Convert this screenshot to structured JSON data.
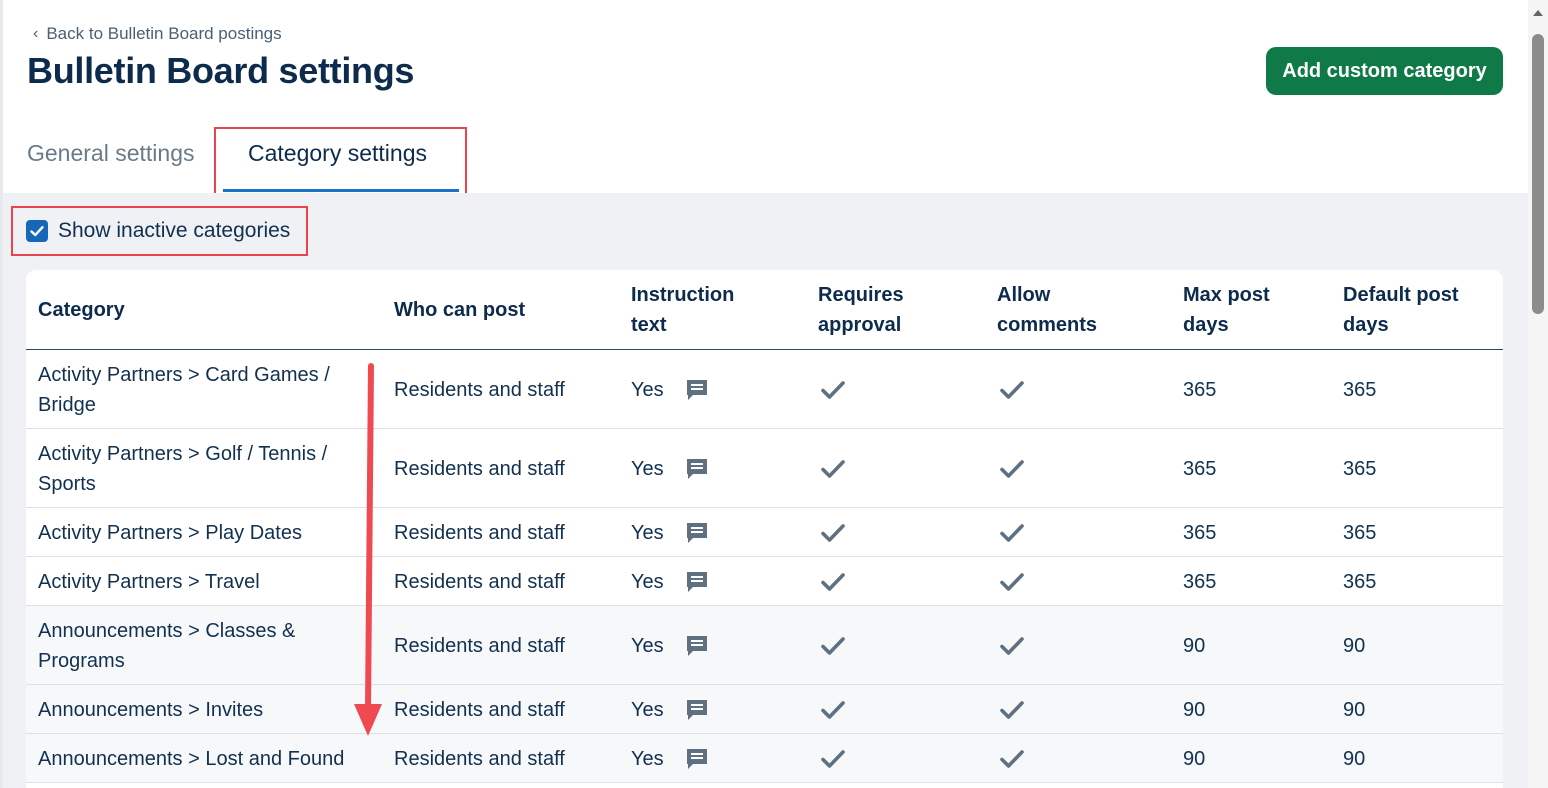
{
  "header": {
    "back_label": "Back to Bulletin Board postings",
    "title": "Bulletin Board settings",
    "add_button": "Add custom category"
  },
  "tabs": [
    {
      "label": "General settings",
      "active": false
    },
    {
      "label": "Category settings",
      "active": true
    }
  ],
  "filter": {
    "show_inactive_label": "Show inactive categories",
    "show_inactive_checked": true
  },
  "table": {
    "headers": {
      "category": "Category",
      "who": "Who can post",
      "instruction_line1": "Instruction",
      "instruction_line2": "text",
      "approval_line1": "Requires",
      "approval_line2": "approval",
      "comments_line1": "Allow",
      "comments_line2": "comments",
      "max_line1": "Max post",
      "max_line2": "days",
      "default_line1": "Default post",
      "default_line2": "days"
    },
    "rows": [
      {
        "category_line1": "Activity Partners > Card Games /",
        "category_line2": "Bridge",
        "who": "Residents and staff",
        "instruction": "Yes",
        "requires_approval": true,
        "allow_comments": true,
        "max_days": "365",
        "default_days": "365"
      },
      {
        "category_line1": "Activity Partners > Golf / Tennis /",
        "category_line2": "Sports",
        "who": "Residents and staff",
        "instruction": "Yes",
        "requires_approval": true,
        "allow_comments": true,
        "max_days": "365",
        "default_days": "365"
      },
      {
        "category_line1": "Activity Partners > Play Dates",
        "category_line2": "",
        "who": "Residents and staff",
        "instruction": "Yes",
        "requires_approval": true,
        "allow_comments": true,
        "max_days": "365",
        "default_days": "365"
      },
      {
        "category_line1": "Activity Partners > Travel",
        "category_line2": "",
        "who": "Residents and staff",
        "instruction": "Yes",
        "requires_approval": true,
        "allow_comments": true,
        "max_days": "365",
        "default_days": "365"
      },
      {
        "category_line1": "Announcements > Classes &",
        "category_line2": "Programs",
        "who": "Residents and staff",
        "instruction": "Yes",
        "requires_approval": true,
        "allow_comments": true,
        "max_days": "90",
        "default_days": "90"
      },
      {
        "category_line1": "Announcements > Invites",
        "category_line2": "",
        "who": "Residents and staff",
        "instruction": "Yes",
        "requires_approval": true,
        "allow_comments": true,
        "max_days": "90",
        "default_days": "90"
      },
      {
        "category_line1": "Announcements > Lost and Found",
        "category_line2": "",
        "who": "Residents and staff",
        "instruction": "Yes",
        "requires_approval": true,
        "allow_comments": true,
        "max_days": "90",
        "default_days": "90"
      }
    ]
  },
  "colors": {
    "primary_button": "#0f7a47",
    "tab_underline": "#1a73c9",
    "annotation_red": "#e8434f",
    "checkbox": "#1767b8",
    "title_text": "#0d2b4c"
  },
  "icons": {
    "back": "chevron-left-icon",
    "instruction": "comment-icon",
    "check": "checkmark-icon",
    "annotation": "red-arrow-down-icon"
  }
}
